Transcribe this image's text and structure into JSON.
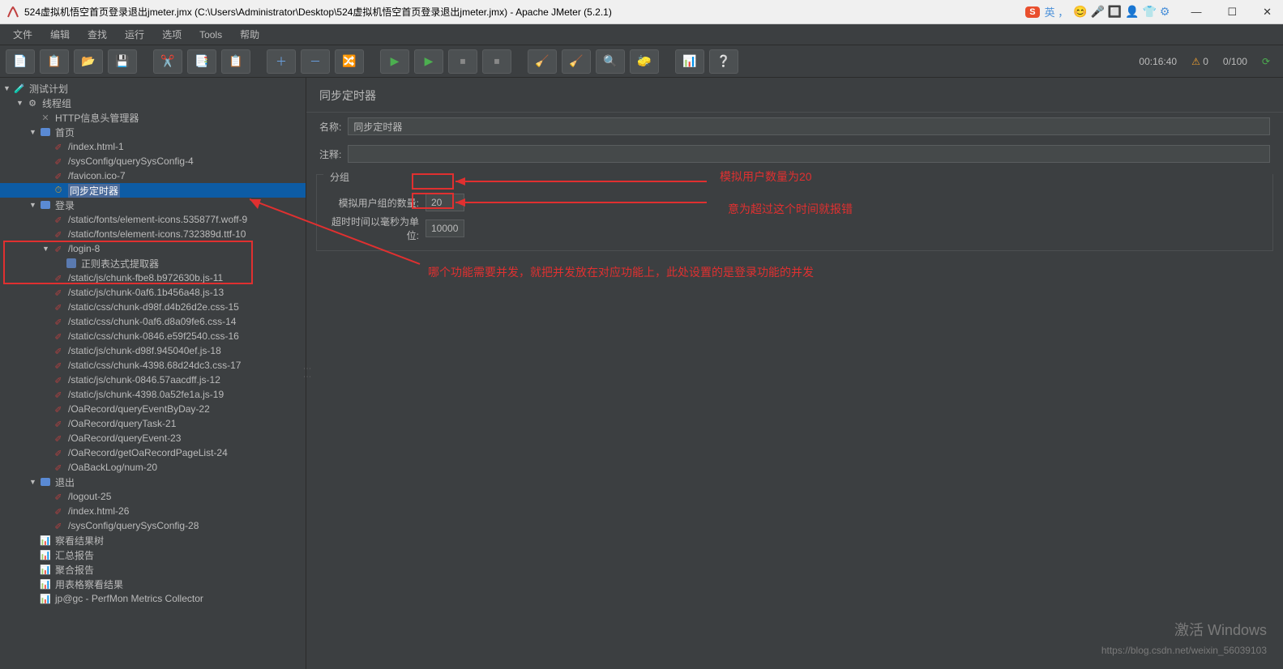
{
  "titlebar": {
    "title": "524虚拟机悟空首页登录退出jmeter.jmx (C:\\Users\\Administrator\\Desktop\\524虚拟机悟空首页登录退出jmeter.jmx) - Apache JMeter (5.2.1)",
    "ime_badge": "S",
    "ime_text": "英 ，"
  },
  "winbtns": {
    "min": "—",
    "max": "☐",
    "close": "✕"
  },
  "menu": {
    "file": "文件",
    "edit": "编辑",
    "search": "查找",
    "run": "运行",
    "options": "选项",
    "tools": "Tools",
    "help": "帮助"
  },
  "status": {
    "time": "00:16:40",
    "warnings": "0",
    "threads": "0/100"
  },
  "tree": {
    "testplan": "测试计划",
    "threadgroup": "线程组",
    "httpheader": "HTTP信息头管理器",
    "homepage": "首页",
    "home_items": [
      "/index.html-1",
      "/sysConfig/querySysConfig-4",
      "/favicon.ico-7"
    ],
    "timer": "同步定时器",
    "login": "登录",
    "login_items": [
      "/static/fonts/element-icons.535877f.woff-9",
      "/static/fonts/element-icons.732389d.ttf-10"
    ],
    "login8": "/login-8",
    "regex": "正则表达式提取器",
    "login8_items": [
      "/static/js/chunk-fbe8.b972630b.js-11",
      "/static/js/chunk-0af6.1b456a48.js-13",
      "/static/css/chunk-d98f.d4b26d2e.css-15",
      "/static/css/chunk-0af6.d8a09fe6.css-14",
      "/static/css/chunk-0846.e59f2540.css-16",
      "/static/js/chunk-d98f.945040ef.js-18",
      "/static/css/chunk-4398.68d24dc3.css-17",
      "/static/js/chunk-0846.57aacdff.js-12",
      "/static/js/chunk-4398.0a52fe1a.js-19",
      "/OaRecord/queryEventByDay-22",
      "/OaRecord/queryTask-21",
      "/OaRecord/queryEvent-23",
      "/OaRecord/getOaRecordPageList-24",
      "/OaBackLog/num-20"
    ],
    "logout": "退出",
    "logout_items": [
      "/logout-25",
      "/index.html-26",
      "/sysConfig/querySysConfig-28"
    ],
    "listeners": [
      "察看结果树",
      "汇总报告",
      "聚合报告",
      "用表格察看结果",
      "jp@gc - PerfMon Metrics Collector"
    ]
  },
  "panel": {
    "title": "同步定时器",
    "name_label": "名称:",
    "name_value": "同步定时器",
    "comment_label": "注释:",
    "comment_value": "",
    "group_legend": "分组",
    "users_label": "模拟用户组的数量:",
    "users_value": "20",
    "timeout_label": "超时时间以毫秒为单位:",
    "timeout_value": "10000"
  },
  "annotations": {
    "a1": "模拟用户数量为20",
    "a2": "意为超过这个时间就报错",
    "a3": "哪个功能需要并发，就把并发放在对应功能上，此处设置的是登录功能的并发"
  },
  "watermark": {
    "windows": "激活 Windows",
    "url": "https://blog.csdn.net/weixin_56039103"
  }
}
